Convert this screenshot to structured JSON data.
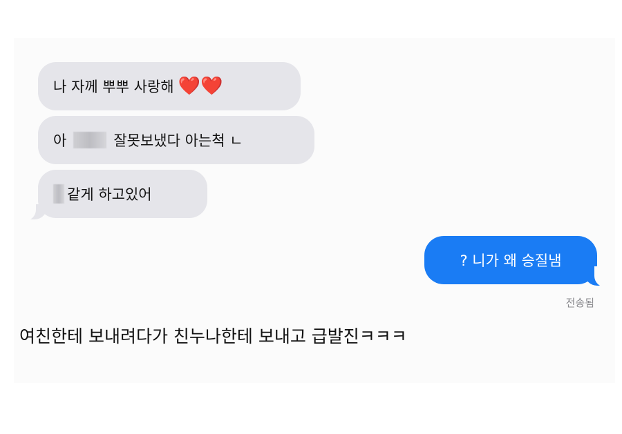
{
  "messages": {
    "incoming": [
      {
        "text": "나 자께 뿌뿌 사랑해",
        "emoji": "❤️❤️"
      },
      {
        "before": "아",
        "after": "잘못보냈다 아는척 ㄴ"
      },
      {
        "after": "같게 하고있어"
      }
    ],
    "outgoing": {
      "text": "? 니가 왜 승질냄",
      "status": "전송됨"
    }
  },
  "caption": "여친한테 보내려다가 친누나한테 보내고 급발진ㅋㅋㅋ",
  "colors": {
    "incoming_bubble": "#e5e5ea",
    "outgoing_bubble": "#1a7cf4",
    "background": "#fbfbfb"
  }
}
